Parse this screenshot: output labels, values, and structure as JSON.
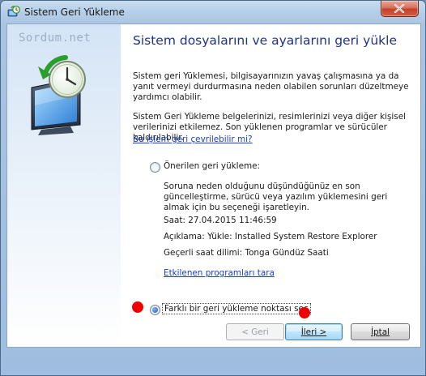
{
  "window": {
    "title": "Sistem Geri Yükleme"
  },
  "brand": "Sordum.net",
  "main": {
    "heading": "Sistem dosyalarını ve ayarlarını geri yükle",
    "para1": "Sistem geri Yüklemesi, bilgisayarınızın yavaş çalışmasına ya da yanıt vermeyi durdurmasına neden olabilen sorunları düzeltmeye yardımcı olabilir.",
    "para2": "Sistem Geri Yükleme belgelerinizi, resimlerinizi veya diğer kişisel verilerinizi etkilemez. Son yüklenen programlar ve sürücüler kaldırılabilir.",
    "learn_link": "Bu işlem geri çevrilebilir mi?",
    "recommended_label": "Önerilen geri yükleme:",
    "recommended_desc": "Soruna neden olduğunu düşündüğünüz en son güncelleştirme, sürücü veya yazılım yüklemesini geri almak için bu seçeneği işaretleyin.",
    "date_line": "Saat: 27.04.2015 11:46:59",
    "desc_line": "Açıklama: Yükle: Installed System Restore Explorer",
    "tz_line": "Geçerli saat dilimi: Tonga Gündüz Saati",
    "affected_link": "Etkilenen programları tara",
    "choose_label": "Farklı bir geri yükleme noktası seç"
  },
  "buttons": {
    "back": "< Geri",
    "next": "İleri >",
    "cancel": "İptal"
  },
  "state": {
    "selected_option": "choose"
  },
  "colors": {
    "heading": "#1e3287",
    "link": "#1a3ec8",
    "annotation_dot": "#ee0000"
  },
  "icons": {
    "title": "system-restore-icon",
    "art": "computer-clock-restore-icon",
    "close": "close-icon"
  }
}
